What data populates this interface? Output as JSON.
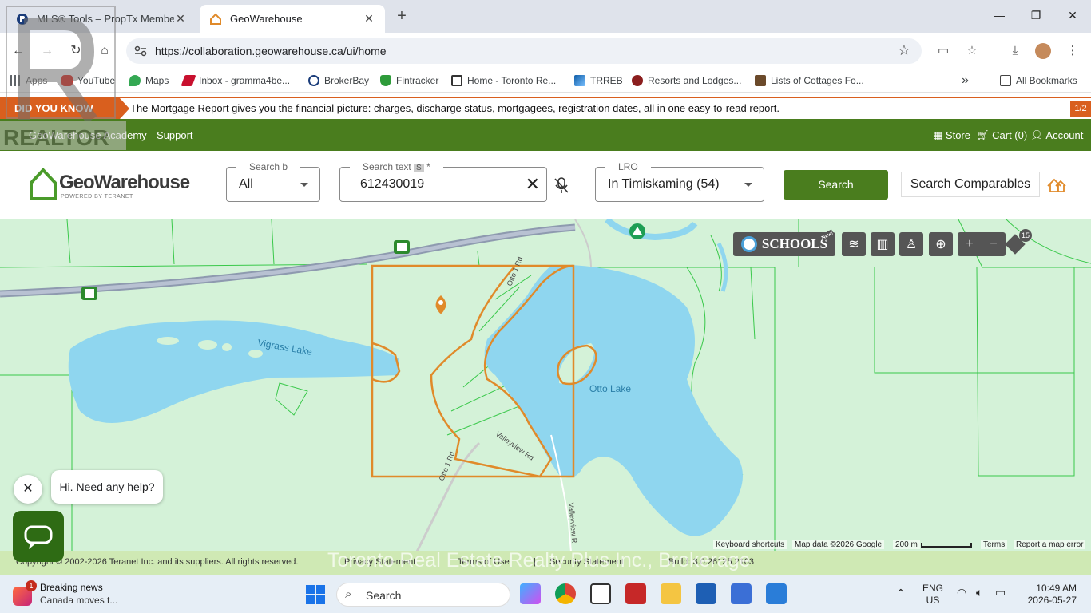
{
  "browser": {
    "tabs": [
      {
        "title": "MLS® Tools – PropTx Member",
        "active": false
      },
      {
        "title": "GeoWarehouse",
        "active": true
      }
    ],
    "url": "https://collaboration.geowarehouse.ca/ui/home",
    "bookmarks": [
      "Apps",
      "YouTube",
      "Maps",
      "Inbox - gramma4be...",
      "BrokerBay",
      "Fintracker",
      "Home - Toronto Re...",
      "TRREB",
      "Resorts and Lodges...",
      "Lists of Cottages Fo..."
    ],
    "all_bookmarks": "All Bookmarks",
    "overflow": "»"
  },
  "banner": {
    "label": "DID YOU KNOW",
    "message": "The Mortgage Report gives you the financial picture: charges, discharge status, mortgagees, registration dates, all in one easy-to-read report.",
    "counter": "1/2"
  },
  "watermark_logo": "REALTOR",
  "nav": {
    "academy": "GeoWarehouse Academy",
    "support": "Support",
    "store": "Store",
    "cart": "Cart (0)",
    "account": "Account"
  },
  "search": {
    "logo_text": "GeoWarehouse",
    "logo_sub": "POWERED BY TERANET",
    "search_by_label": "Search b",
    "search_by_value": "All",
    "text_label": "Search text",
    "text_badge": "S",
    "text_required": "*",
    "text_value": "612430019",
    "lro_label": "LRO",
    "lro_value": "In Timiskaming (54)",
    "search_button": "Search",
    "comparables_button": "Search Comparables"
  },
  "map": {
    "labels": {
      "vigrass": "Vigrass Lake",
      "otto_lake": "Otto Lake",
      "otto_rd_n": "Otto 1 Rd",
      "otto_rd_s": "Otto 1 Rd",
      "valleyview": "Valleyview Rd",
      "valleyview_s": "Valleyview R"
    },
    "schools": "SCHOOLS",
    "schools_badge": "New!",
    "layer_badge": "15",
    "attribution": {
      "shortcuts": "Keyboard shortcuts",
      "data": "Map data ©2026 Google",
      "scale": "200 m",
      "terms": "Terms",
      "report": "Report a map error"
    }
  },
  "footer": {
    "copyright": "Copyright © 2002-2026 Teranet Inc. and its suppliers. All rights reserved.",
    "privacy": "Privacy Statement",
    "terms": "Terms of Use",
    "security": "Security Statement",
    "build": "Build: 3.0.26125.2103",
    "watermark": "Toronto Real Estate Realty Plus Inc., Brokerage"
  },
  "chat": {
    "greeting": "Hi. Need any help?"
  },
  "taskbar": {
    "news_badge": "1",
    "news_title": "Breaking news",
    "news_sub": "Canada moves t...",
    "search": "Search",
    "lang1": "ENG",
    "lang2": "US",
    "time": "10:49 AM",
    "date": "2026-05-27"
  },
  "colors": {
    "brand_green": "#4a7d1e",
    "banner_orange": "#d95f1e",
    "parcel_outline": "#e08a2a",
    "water": "#8fd6ef"
  }
}
